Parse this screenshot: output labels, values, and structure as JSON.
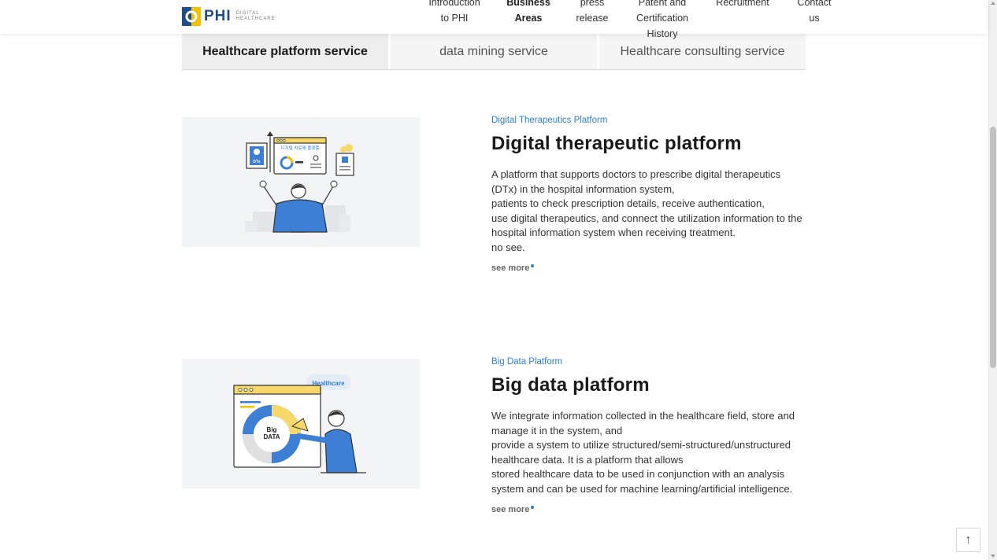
{
  "logo": {
    "text": "PHI",
    "sub_line1": "DIGITAL",
    "sub_line2": "HEALTHCARE"
  },
  "nav": [
    {
      "line1": "Introduction",
      "line2": "to PHI",
      "line3": ""
    },
    {
      "line1": "Business",
      "line2": "Areas",
      "line3": ""
    },
    {
      "line1": "press",
      "line2": "release",
      "line3": ""
    },
    {
      "line1": "Patent and",
      "line2": "Certification",
      "line3": "History"
    },
    {
      "line1": "Recruitment",
      "line2": "",
      "line3": ""
    },
    {
      "line1": "Contact",
      "line2": "us",
      "line3": ""
    }
  ],
  "tabs": [
    {
      "label": "Healthcare platform service",
      "active": true
    },
    {
      "label": "data mining service",
      "active": false
    },
    {
      "label": "Healthcare consulting service",
      "active": false
    }
  ],
  "sections": [
    {
      "eyebrow": "Digital Therapeutics Platform",
      "heading": "Digital therapeutic platform",
      "lines": [
        "A platform that supports doctors to prescribe digital therapeutics (DTx) in the hospital information system,",
        "patients to check prescription details, receive authentication,",
        "use digital therapeutics, and connect the utilization information to the hospital information system when receiving treatment.",
        "no see."
      ],
      "see_more": "see more",
      "illustration": {
        "window_title": "디지털 치료제 플랫폼",
        "badge": "DTx"
      }
    },
    {
      "eyebrow": "Big Data Platform",
      "heading": "Big data platform",
      "lines": [
        "We integrate information collected in the healthcare field, store and manage it in the system, and",
        "provide a system to utilize structured/semi-structured/unstructured healthcare data. It is a platform that allows",
        "stored healthcare data to be used in conjunction with an analysis system and can be used for machine learning/artificial intelligence."
      ],
      "see_more": "see more",
      "illustration": {
        "bubble": "Healthcare",
        "center_line1": "Big",
        "center_line2": "DATA"
      }
    }
  ],
  "top_button": {
    "icon": "arrow-up-icon",
    "glyph": "↑"
  },
  "colors": {
    "accent": "#2f7fd0",
    "brand": "#1f4e8c",
    "brand_yellow": "#f2c200"
  }
}
